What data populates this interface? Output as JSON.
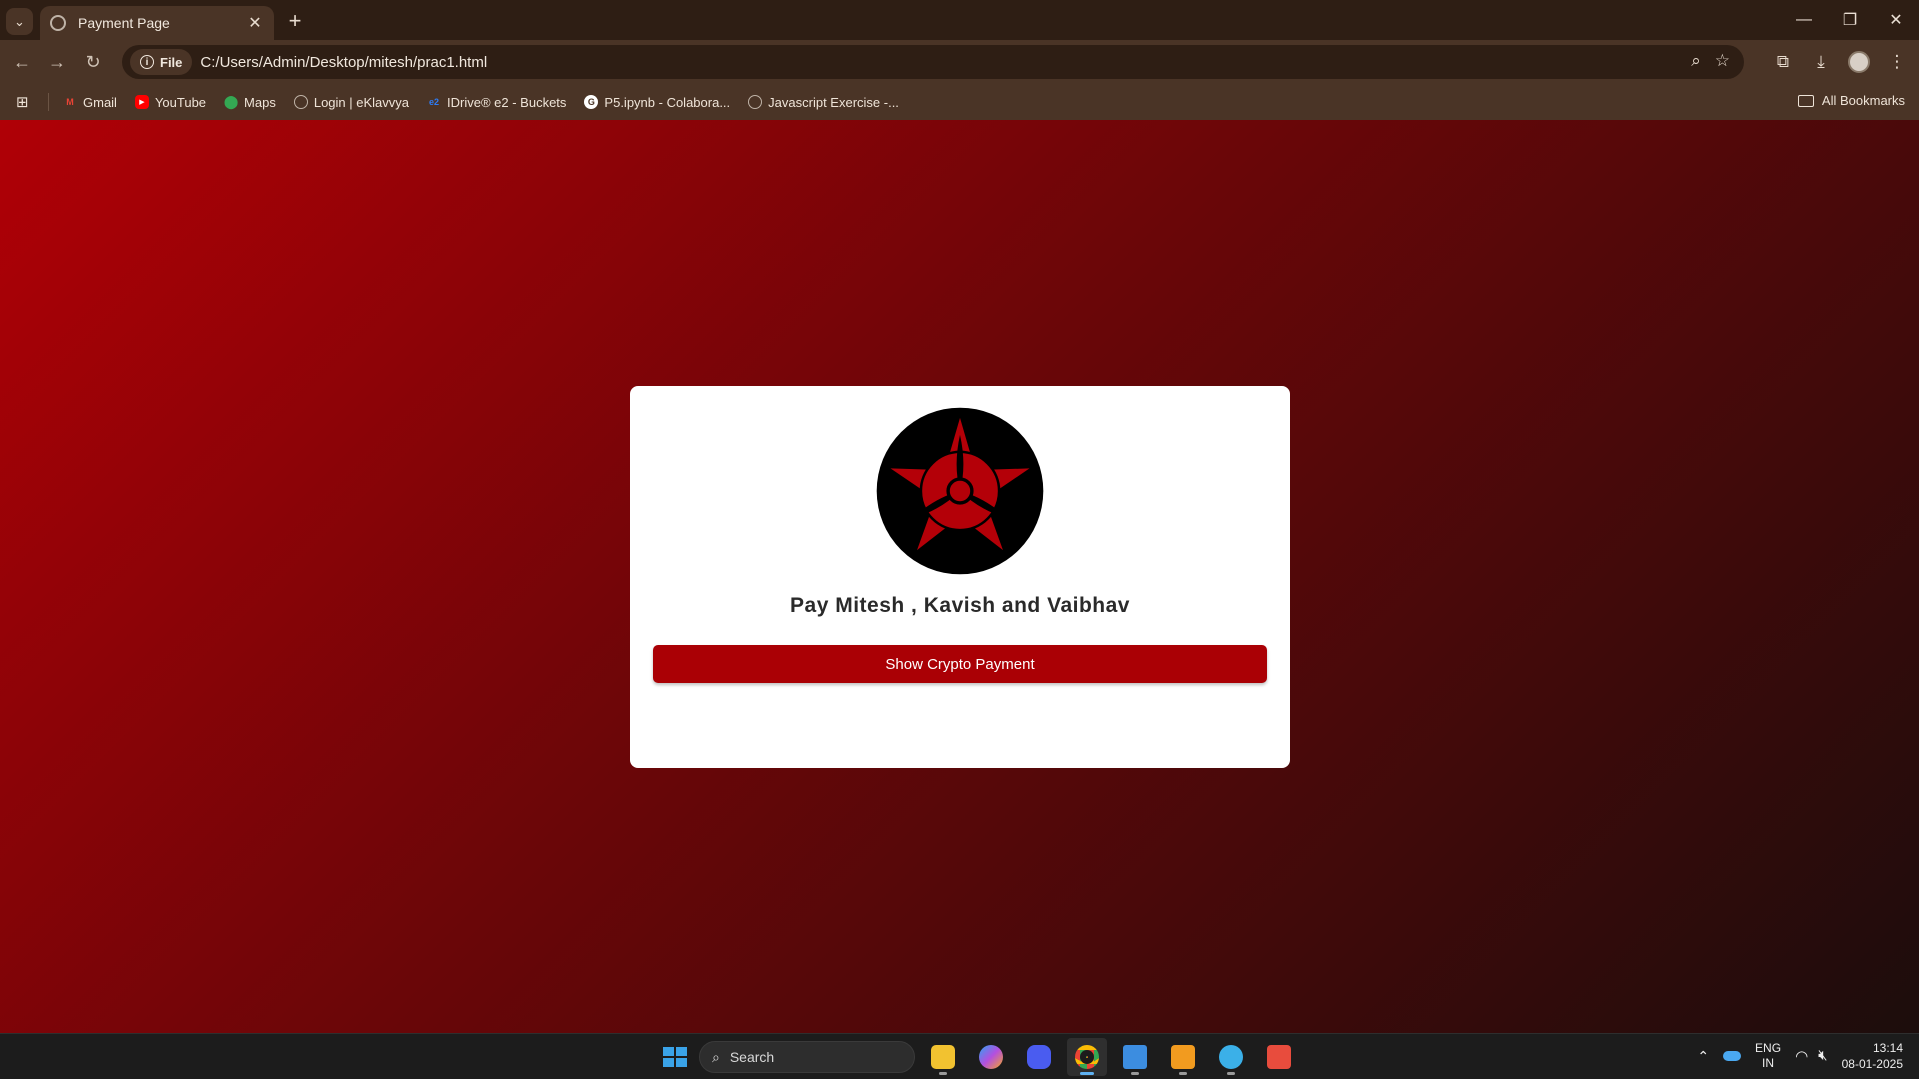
{
  "browser": {
    "tab_title": "Payment Page",
    "address_chip": "File",
    "url": "C:/Users/Admin/Desktop/mitesh/prac1.html",
    "bookmarks": [
      {
        "label": "Gmail",
        "icon": "gmail-icon",
        "color": "#ea4335"
      },
      {
        "label": "YouTube",
        "icon": "youtube-icon",
        "color": "#ff0000"
      },
      {
        "label": "Maps",
        "icon": "maps-icon",
        "color": "#34a853"
      },
      {
        "label": "Login | eKlavvya",
        "icon": "globe-icon",
        "color": "#bfb3a7"
      },
      {
        "label": "IDrive® e2 - Buckets",
        "icon": "idrive-icon",
        "color": "#2e7cf6"
      },
      {
        "label": "P5.ipynb - Colabora...",
        "icon": "google-icon",
        "color": "#ffffff"
      },
      {
        "label": "Javascript Exercise -...",
        "icon": "globe-icon",
        "color": "#bfb3a7"
      }
    ],
    "all_bookmarks": "All Bookmarks"
  },
  "page": {
    "heading": "Pay Mitesh , Kavish and Vaibhav",
    "button_label": "Show Crypto Payment",
    "accent_color": "#aa0005",
    "logo_icon": "sharingan-logo"
  },
  "taskbar": {
    "search_label": "Search",
    "lang_line1": "ENG",
    "lang_line2": "IN",
    "time": "13:14",
    "date": "08-01-2025"
  }
}
